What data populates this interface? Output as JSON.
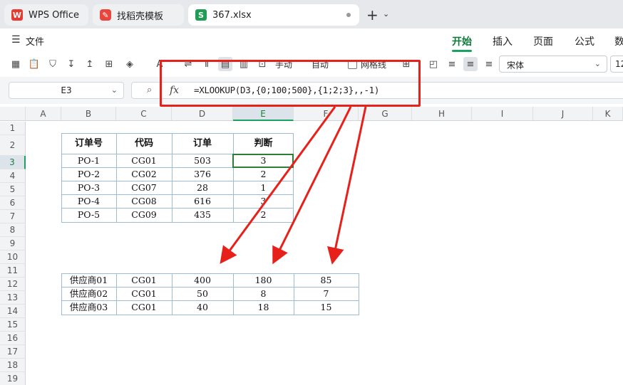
{
  "tabs": [
    {
      "label": "WPS Office",
      "icon": "wps-logo-icon"
    },
    {
      "label": "找稻壳模板",
      "icon": "daoke-icon"
    },
    {
      "label": "367.xlsx",
      "icon": "spreadsheet-icon",
      "glyph": "S"
    }
  ],
  "menu": {
    "file_label": "文件",
    "tabs": [
      "开始",
      "插入",
      "页面",
      "公式",
      "数"
    ],
    "active": "开始"
  },
  "toolbar": {
    "manual_label": "手动",
    "auto_label": "自动",
    "gridlines_label": "网格线",
    "font_name": "宋体",
    "font_size": "12"
  },
  "formula_bar": {
    "name_box": "E3",
    "fx": "fx",
    "formula": "=XLOOKUP(D3,{0;100;500},{1;2;3},,-1)"
  },
  "columns": [
    "A",
    "B",
    "C",
    "D",
    "E",
    "F",
    "G",
    "H",
    "I",
    "J",
    "K"
  ],
  "rows": [
    "1",
    "2",
    "3",
    "4",
    "5",
    "6",
    "7",
    "8",
    "9",
    "10",
    "11",
    "12",
    "13",
    "14",
    "15",
    "16",
    "17",
    "18",
    "19"
  ],
  "table1": {
    "headers": [
      "订单号",
      "代码",
      "订单",
      "判断"
    ],
    "rows": [
      [
        "PO-1",
        "CG01",
        "503",
        "3"
      ],
      [
        "PO-2",
        "CG02",
        "376",
        "2"
      ],
      [
        "PO-3",
        "CG07",
        "28",
        "1"
      ],
      [
        "PO-4",
        "CG08",
        "616",
        "3"
      ],
      [
        "PO-5",
        "CG09",
        "435",
        "2"
      ]
    ]
  },
  "table2": {
    "rows": [
      [
        "供应商01",
        "CG01",
        "400",
        "180",
        "85"
      ],
      [
        "供应商02",
        "CG01",
        "50",
        "8",
        "7"
      ],
      [
        "供应商03",
        "CG01",
        "40",
        "18",
        "15"
      ]
    ]
  },
  "colors": {
    "accent_green": "#1aa260",
    "annotation_red": "#e8201a",
    "table_border": "#9dbad8"
  }
}
